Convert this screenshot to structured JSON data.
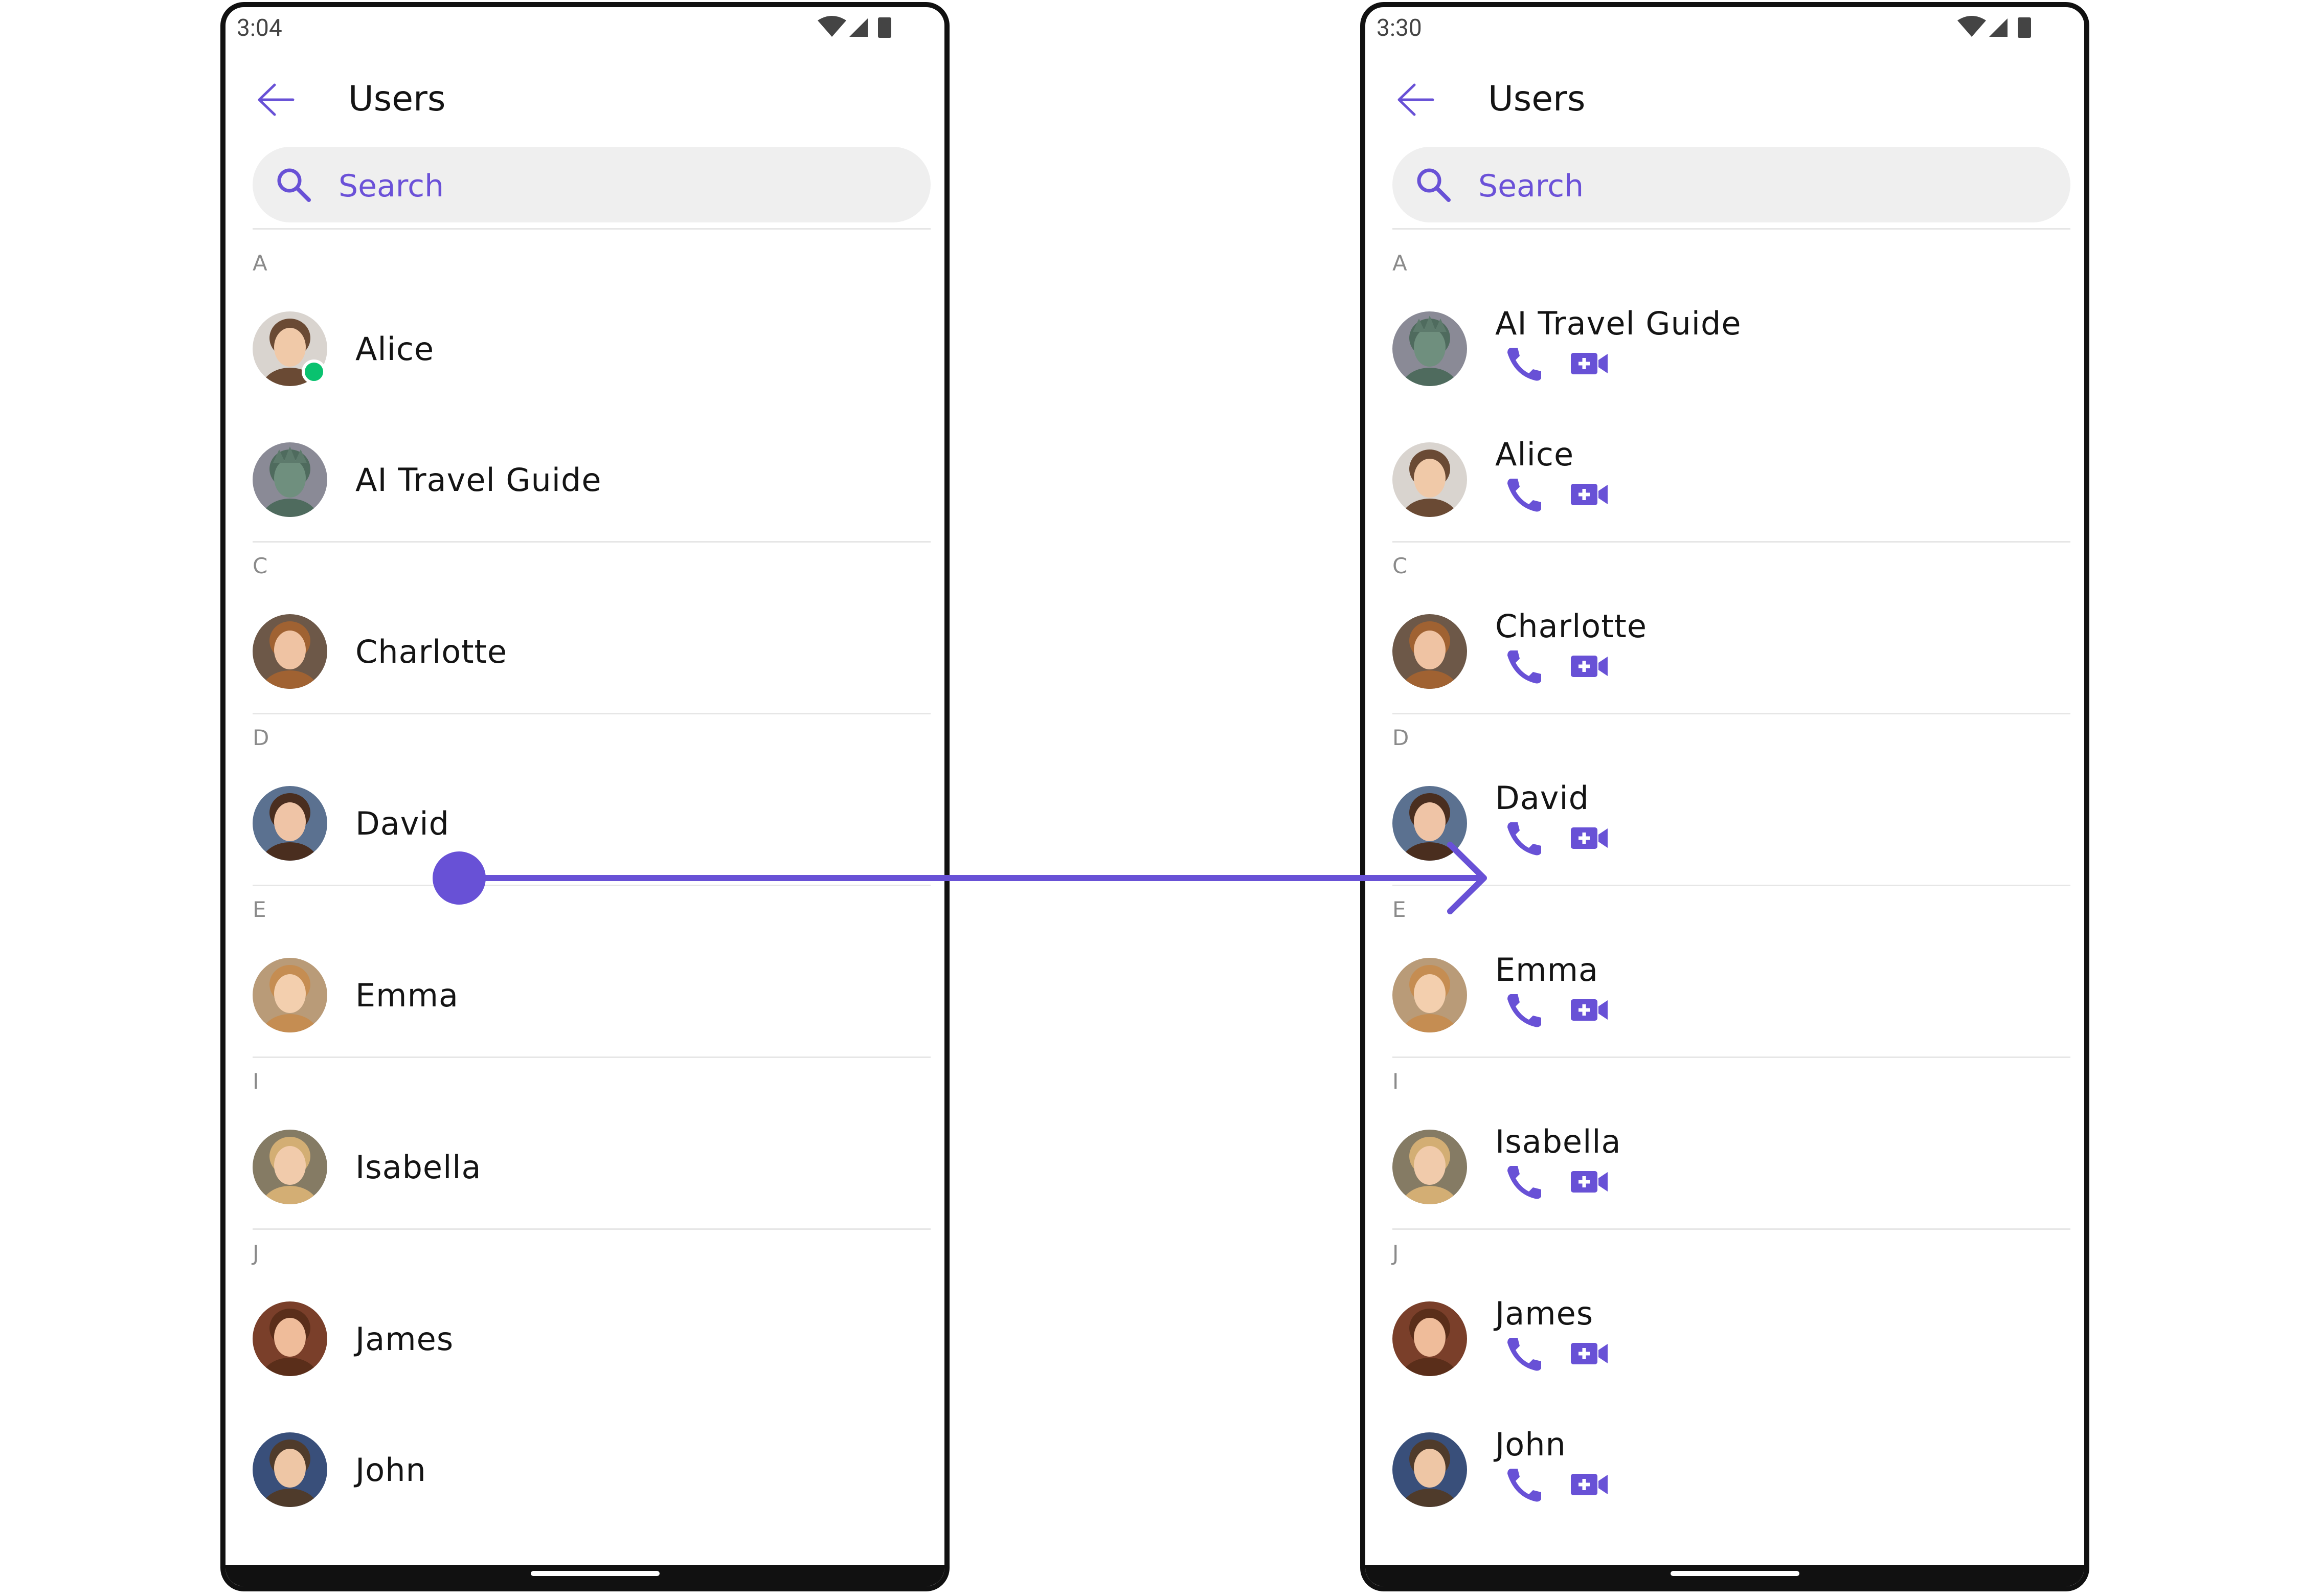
{
  "accent": "#6851d6",
  "online_color": "#09c26f",
  "screens": [
    {
      "status_time": "3:04",
      "title": "Users",
      "search_placeholder": "Search",
      "sections": [
        {
          "letter": "A",
          "users": [
            {
              "name": "Alice",
              "avatar": "alice",
              "online": true
            },
            {
              "name": "AI Travel Guide",
              "avatar": "statue",
              "online": false
            }
          ]
        },
        {
          "letter": "C",
          "users": [
            {
              "name": "Charlotte",
              "avatar": "charlotte",
              "online": false
            }
          ]
        },
        {
          "letter": "D",
          "users": [
            {
              "name": "David",
              "avatar": "david",
              "online": false
            }
          ]
        },
        {
          "letter": "E",
          "users": [
            {
              "name": "Emma",
              "avatar": "emma",
              "online": false
            }
          ]
        },
        {
          "letter": "I",
          "users": [
            {
              "name": "Isabella",
              "avatar": "isabella",
              "online": false
            }
          ]
        },
        {
          "letter": "J",
          "users": [
            {
              "name": "James",
              "avatar": "james",
              "online": false
            },
            {
              "name": "John",
              "avatar": "john",
              "online": false
            }
          ]
        }
      ],
      "show_actions": false
    },
    {
      "status_time": "3:30",
      "title": "Users",
      "search_placeholder": "Search",
      "sections": [
        {
          "letter": "A",
          "users": [
            {
              "name": "AI Travel Guide",
              "avatar": "statue",
              "online": false
            },
            {
              "name": "Alice",
              "avatar": "alice",
              "online": false
            }
          ]
        },
        {
          "letter": "C",
          "users": [
            {
              "name": "Charlotte",
              "avatar": "charlotte",
              "online": false
            }
          ]
        },
        {
          "letter": "D",
          "users": [
            {
              "name": "David",
              "avatar": "david",
              "online": false
            }
          ]
        },
        {
          "letter": "E",
          "users": [
            {
              "name": "Emma",
              "avatar": "emma",
              "online": false
            }
          ]
        },
        {
          "letter": "I",
          "users": [
            {
              "name": "Isabella",
              "avatar": "isabella",
              "online": false
            }
          ]
        },
        {
          "letter": "J",
          "users": [
            {
              "name": "James",
              "avatar": "james",
              "online": false
            },
            {
              "name": "John",
              "avatar": "john",
              "online": false
            }
          ]
        }
      ],
      "show_actions": true,
      "actions": [
        {
          "icon": "phone-icon",
          "name": "voice-call-button"
        },
        {
          "icon": "video-camera-icon",
          "name": "video-call-button"
        }
      ]
    }
  ],
  "annotation": {
    "type": "arrow",
    "from": "David row (left screen)",
    "to": "David call buttons (right screen)"
  },
  "icons": {
    "back": "arrow-left-icon",
    "search": "search-icon",
    "status": [
      "wifi-icon",
      "cellular-signal-icon",
      "battery-icon"
    ]
  }
}
